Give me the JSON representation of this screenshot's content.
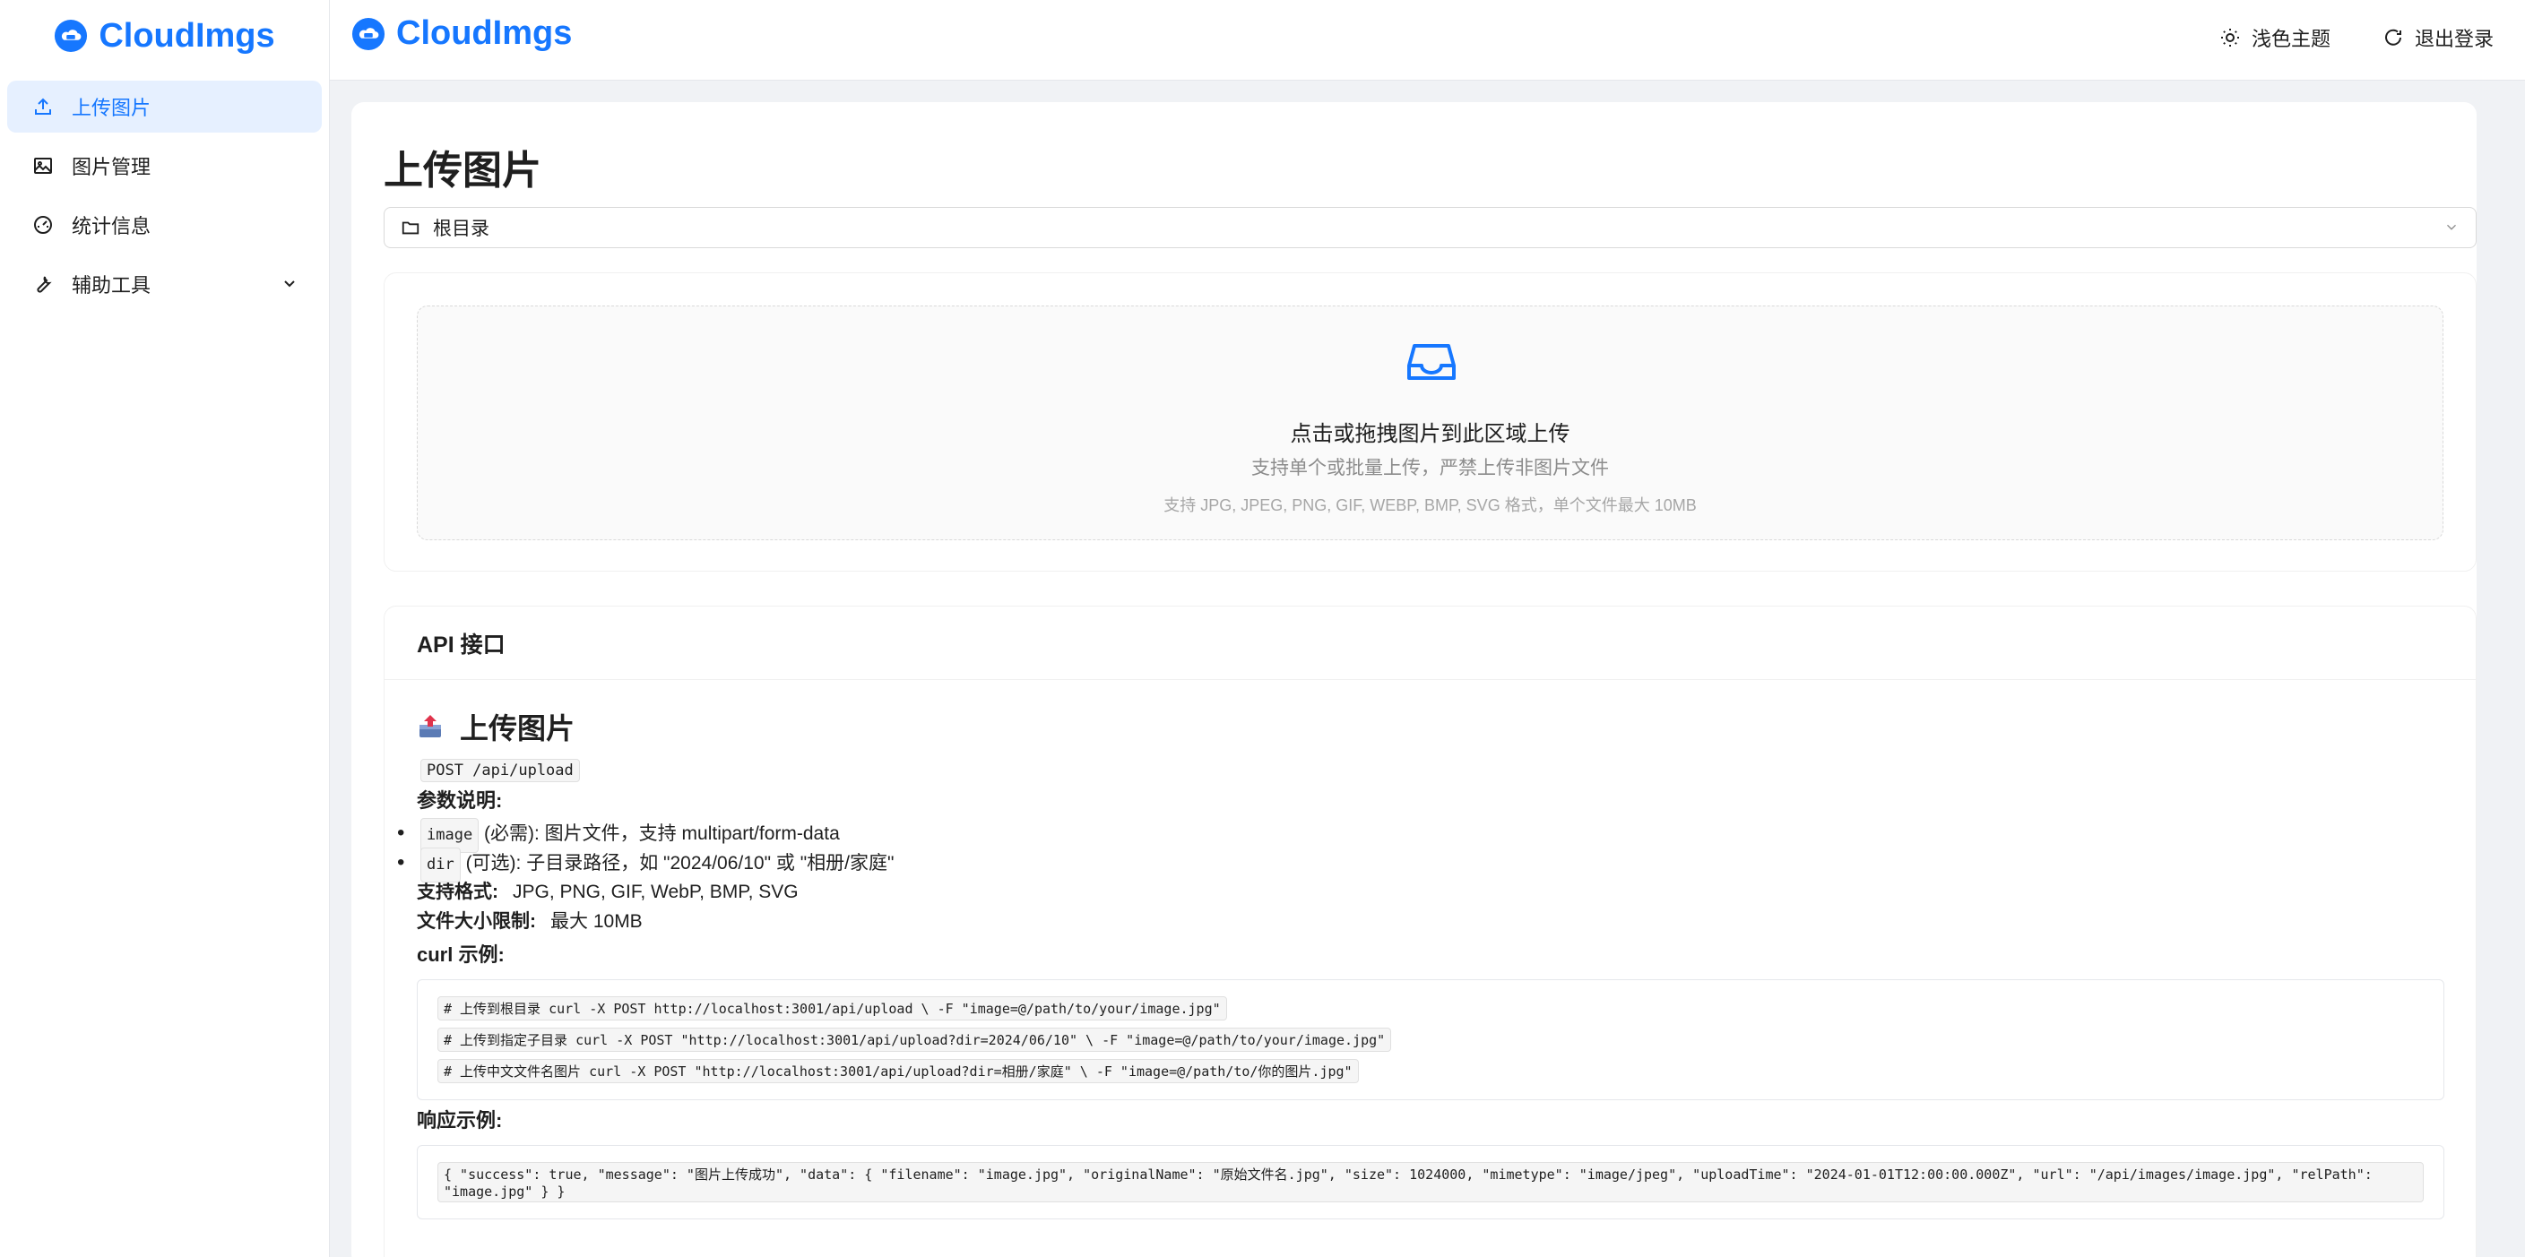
{
  "app": {
    "name": "CloudImgs"
  },
  "sidebar": {
    "items": [
      {
        "label": "上传图片",
        "icon": "upload-icon",
        "active": true
      },
      {
        "label": "图片管理",
        "icon": "image-icon"
      },
      {
        "label": "统计信息",
        "icon": "dashboard-icon"
      },
      {
        "label": "辅助工具",
        "icon": "tool-icon",
        "expandable": true
      }
    ]
  },
  "header": {
    "theme_label": "浅色主题",
    "logout_label": "退出登录"
  },
  "main": {
    "title": "上传图片",
    "directory": {
      "selected": "根目录"
    },
    "upload": {
      "main_text": "点击或拖拽图片到此区域上传",
      "sub_text": "支持单个或批量上传，严禁上传非图片文件",
      "hint_text": "支持 JPG, JPEG, PNG, GIF, WEBP, BMP, SVG 格式，单个文件最大 10MB"
    },
    "api": {
      "heading": "API 接口",
      "section_title": "上传图片",
      "endpoint": "POST /api/upload",
      "params_label": "参数说明:",
      "params": [
        {
          "code": "image",
          "desc": "(必需): 图片文件，支持 multipart/form-data"
        },
        {
          "code": "dir",
          "desc": "(可选): 子目录路径，如 \"2024/06/10\" 或 \"相册/家庭\""
        }
      ],
      "formats_label": "支持格式:",
      "formats_value": "JPG, PNG, GIF, WebP, BMP, SVG",
      "size_label": "文件大小限制:",
      "size_value": "最大 10MB",
      "curl_label": "curl 示例:",
      "curl_lines": [
        "# 上传到根目录 curl -X POST http://localhost:3001/api/upload \\ -F \"image=@/path/to/your/image.jpg\"",
        "# 上传到指定子目录 curl -X POST \"http://localhost:3001/api/upload?dir=2024/06/10\" \\ -F \"image=@/path/to/your/image.jpg\"",
        "# 上传中文文件名图片 curl -X POST \"http://localhost:3001/api/upload?dir=相册/家庭\" \\ -F \"image=@/path/to/你的图片.jpg\""
      ],
      "response_label": "响应示例:",
      "response_json": "{ \"success\": true, \"message\": \"图片上传成功\", \"data\": { \"filename\": \"image.jpg\", \"originalName\": \"原始文件名.jpg\", \"size\": 1024000, \"mimetype\": \"image/jpeg\", \"uploadTime\": \"2024-01-01T12:00:00.000Z\", \"url\": \"/api/images/image.jpg\", \"relPath\": \"image.jpg\" } }"
    }
  },
  "colors": {
    "accent": "#1677ff",
    "active_bg": "#e6f0ff"
  }
}
